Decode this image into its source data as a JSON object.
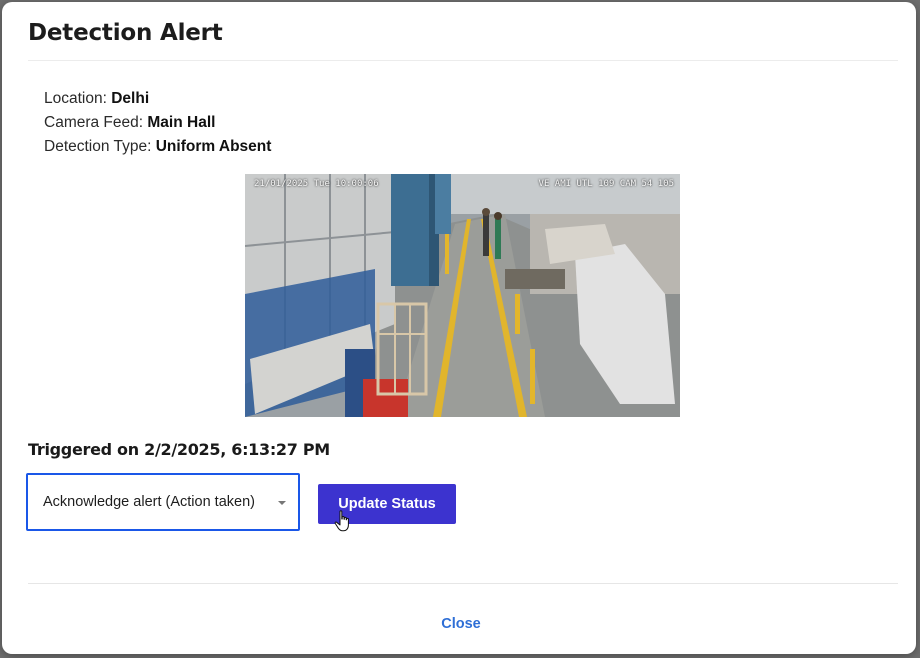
{
  "modal": {
    "title": "Detection Alert"
  },
  "details": {
    "location_label": "Location:",
    "location_value": "Delhi",
    "camera_label": "Camera Feed:",
    "camera_value": "Main Hall",
    "type_label": "Detection Type:",
    "type_value": "Uniform Absent"
  },
  "snapshot": {
    "timestamp_overlay": "21/01/2025 Tue 10:00:06",
    "camera_overlay": "VE AMI UTL 109 CAM 54 105"
  },
  "triggered": {
    "text": "Triggered on 2/2/2025, 6:13:27 PM"
  },
  "status": {
    "selected": "Acknowledge alert (Action taken)",
    "update_label": "Update Status"
  },
  "footer": {
    "close_label": "Close"
  },
  "colors": {
    "primary_button": "#3c33cf",
    "select_focus_border": "#1a57e8",
    "link": "#2f6fd6"
  }
}
